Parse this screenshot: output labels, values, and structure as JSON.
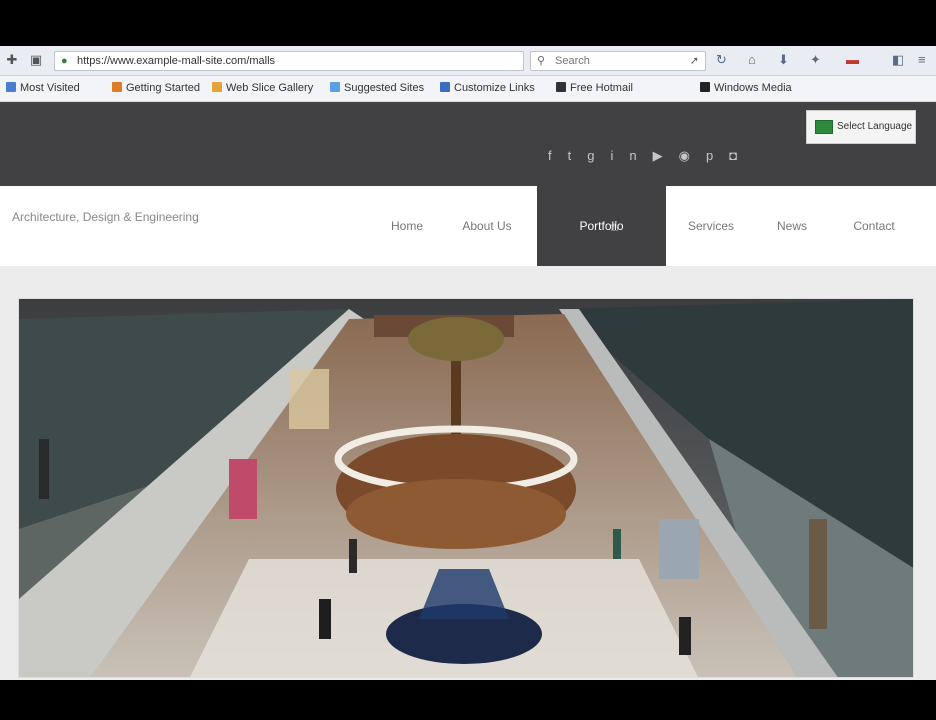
{
  "browser": {
    "url": "https://www.example-mall-site.com/malls",
    "search_placeholder": "Search",
    "bookmarks": [
      {
        "label": "Most Visited",
        "color": "#4a7fd0"
      },
      {
        "label": "Getting Started",
        "color": "#e07b2a"
      },
      {
        "label": "Web Slice Gallery",
        "color": "#e9a23a"
      },
      {
        "label": "Suggested Sites",
        "color": "#5aa0e6"
      },
      {
        "label": "Customize Links",
        "color": "#3a6cc0"
      },
      {
        "label": "Free Hotmail",
        "color": "#333333"
      },
      {
        "label": "Windows Media",
        "color": "#222222"
      }
    ]
  },
  "site": {
    "language_label": "Select Language",
    "social_icons": [
      "facebook-icon",
      "twitter-icon",
      "google-plus-icon",
      "linkedin-icon",
      "youtube-icon",
      "rss-icon",
      "pinterest-icon",
      "instagram-icon"
    ],
    "tagline": "Architecture, Design & Engineering",
    "nav": [
      {
        "label": "Home",
        "active": false
      },
      {
        "label": "About Us",
        "active": false
      },
      {
        "label": "Portfolio",
        "active": true
      },
      {
        "label": "Services",
        "active": false
      },
      {
        "label": "News",
        "active": false
      },
      {
        "label": "Contact",
        "active": false
      }
    ],
    "hero_alt": "Shopping mall atrium"
  },
  "colors": {
    "header_dark": "#414042",
    "nav_active": "#414042",
    "background": "#ececec"
  }
}
